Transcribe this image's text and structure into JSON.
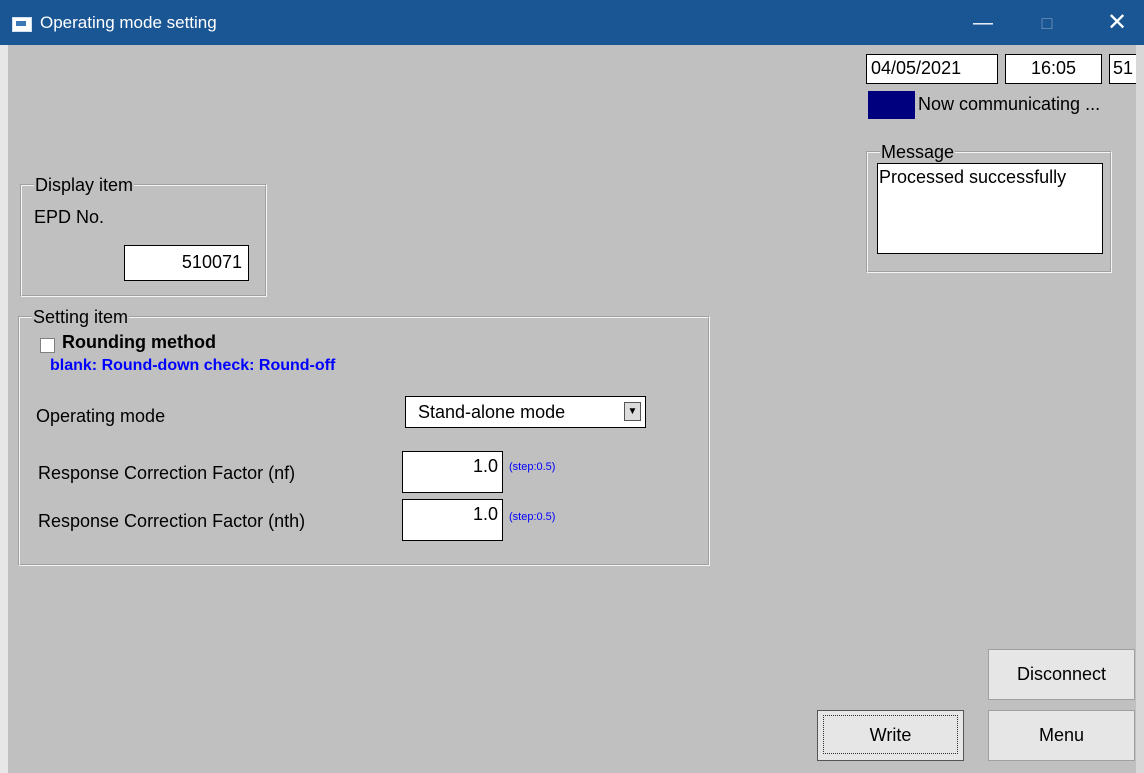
{
  "window": {
    "title": "Operating mode setting",
    "controls": {
      "minimize": "—",
      "maximize": "□",
      "close": "✕"
    }
  },
  "status": {
    "date": "04/05/2021",
    "time": "16:05",
    "code": "51",
    "communication_text": "Now communicating ...",
    "communication_color": "#00007f"
  },
  "message": {
    "legend": "Message",
    "text": "Processed successfully"
  },
  "display_item": {
    "legend": "Display item",
    "epd_label": "EPD No.",
    "epd_value": "510071"
  },
  "setting_item": {
    "legend": "Setting item",
    "rounding_label": "Rounding method",
    "rounding_checked": false,
    "rounding_hint": "blank: Round-down check: Round-off",
    "operating_mode_label": "Operating mode",
    "operating_mode_value": "Stand-alone mode",
    "rcf_nf_label": "Response Correction Factor (nf)",
    "rcf_nf_value": "1.0",
    "rcf_nf_step": "(step:0.5)",
    "rcf_nth_label": "Response Correction Factor (nth)",
    "rcf_nth_value": "1.0",
    "rcf_nth_step": "(step:0.5)"
  },
  "buttons": {
    "disconnect": "Disconnect",
    "write": "Write",
    "menu": "Menu"
  },
  "colors": {
    "titlebar": "#1b5694",
    "hint": "#0000ff",
    "background": "#c0c0c0"
  }
}
